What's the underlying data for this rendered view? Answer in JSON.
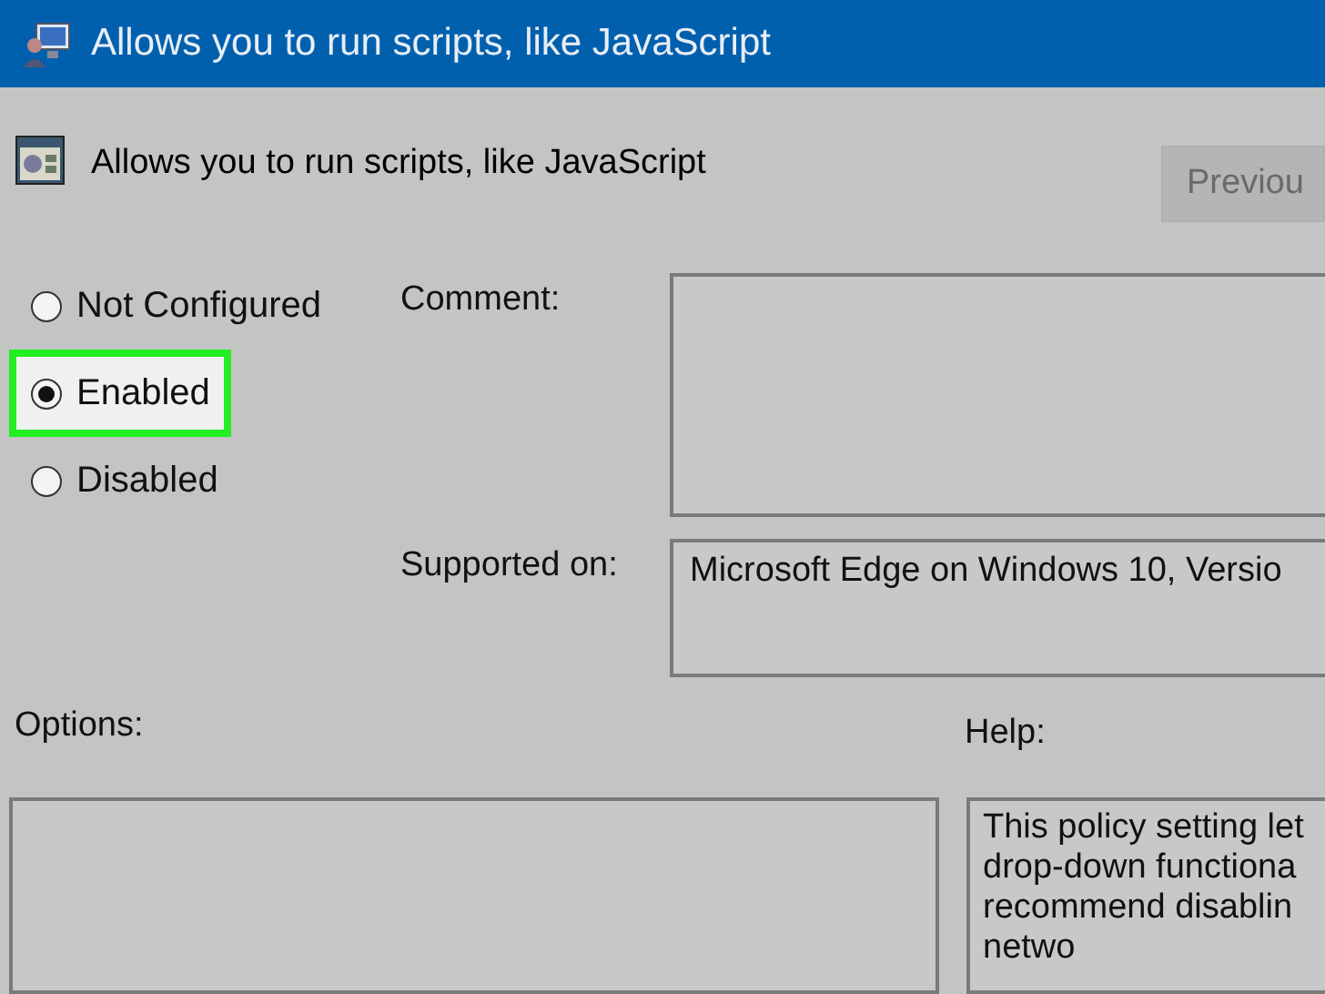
{
  "window": {
    "title": "Allows you to run scripts, like JavaScript"
  },
  "header": {
    "title": "Allows you to run scripts, like JavaScript",
    "previous_button": {
      "label": "Previou",
      "disabled": true
    }
  },
  "options": [
    {
      "label": "Not Configured",
      "selected": false
    },
    {
      "label": "Enabled",
      "selected": true
    },
    {
      "label": "Disabled",
      "selected": false
    }
  ],
  "comment": {
    "label": "Comment:"
  },
  "supported_on": {
    "label": "Supported on:",
    "value": "Microsoft Edge on Windows 10, Versio"
  },
  "options_section": {
    "label": "Options:"
  },
  "help_section": {
    "label": "Help:",
    "lines": [
      "This policy setting let",
      "drop-down functiona",
      "recommend disablin",
      "netwo"
    ]
  }
}
